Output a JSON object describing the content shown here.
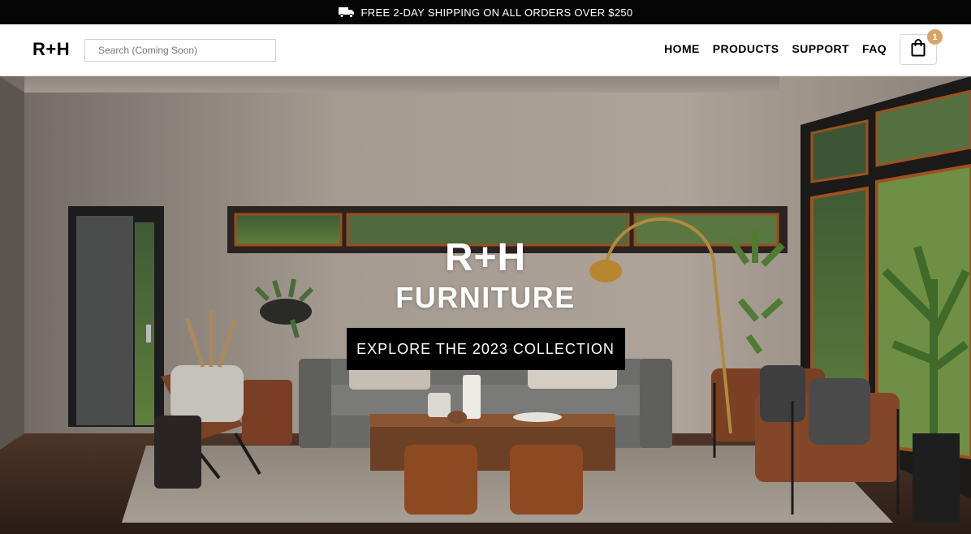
{
  "promo": {
    "icon": "truck-icon",
    "text": "FREE 2-DAY SHIPPING ON ALL ORDERS OVER $250"
  },
  "header": {
    "logo": "R+H",
    "search_placeholder": "Search (Coming Soon)",
    "nav": [
      "HOME",
      "PRODUCTS",
      "SUPPORT",
      "FAQ"
    ],
    "cart": {
      "icon": "shopping-bag-icon",
      "count": "1"
    }
  },
  "hero": {
    "title": "R+H",
    "subtitle": "FURNITURE",
    "cta": "EXPLORE THE 2023 COLLECTION",
    "background": "living-room-photo"
  },
  "colors": {
    "promo_bg": "#050505",
    "badge": "#d8a567",
    "cta_bg": "#000000"
  }
}
